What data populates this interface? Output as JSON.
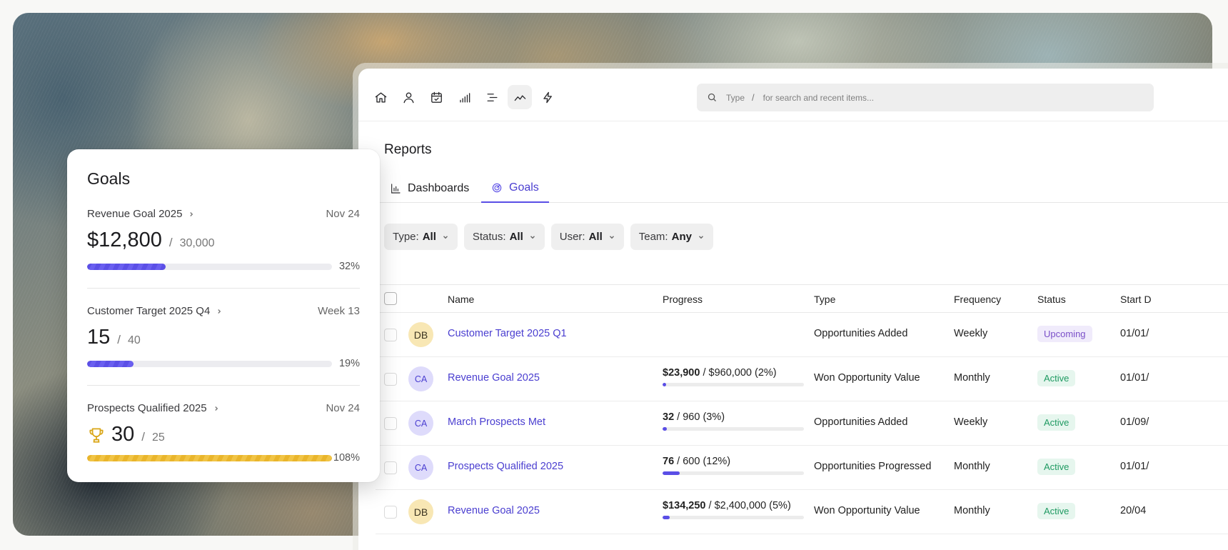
{
  "search": {
    "prefix": "Type",
    "key": "/",
    "suffix": "for search and recent items..."
  },
  "nav": [
    "home-icon",
    "user-icon",
    "calendar-check-icon",
    "signal-bars-icon",
    "list-icon",
    "trend-line-icon",
    "lightning-icon"
  ],
  "page": {
    "title": "Reports"
  },
  "tabs": [
    {
      "label": "Dashboards",
      "icon": "bar-chart-icon"
    },
    {
      "label": "Goals",
      "icon": "target-icon"
    }
  ],
  "filters": [
    {
      "label": "Type:",
      "value": "All"
    },
    {
      "label": "Status:",
      "value": "All"
    },
    {
      "label": "User:",
      "value": "All"
    },
    {
      "label": "Team:",
      "value": "Any"
    }
  ],
  "table": {
    "headers": {
      "name": "Name",
      "progress": "Progress",
      "type": "Type",
      "frequency": "Frequency",
      "status": "Status",
      "start": "Start D"
    },
    "rows": [
      {
        "avatar": "DB",
        "name": "Customer Target 2025 Q1",
        "progress_bold": "",
        "progress_rest": "",
        "progress_fraction": 0,
        "type": "Opportunities Added",
        "frequency": "Weekly",
        "status": "Upcoming",
        "start": "01/01/"
      },
      {
        "avatar": "CA",
        "name": "Revenue Goal 2025",
        "progress_bold": "$23,900",
        "progress_rest": " / $960,000 (2%)",
        "progress_fraction": 0.02,
        "type": "Won Opportunity Value",
        "frequency": "Monthly",
        "status": "Active",
        "start": "01/01/"
      },
      {
        "avatar": "CA",
        "name": "March Prospects Met",
        "progress_bold": "32",
        "progress_rest": " / 960 (3%)",
        "progress_fraction": 0.03,
        "type": "Opportunities Added",
        "frequency": "Weekly",
        "status": "Active",
        "start": "01/09/"
      },
      {
        "avatar": "CA",
        "name": "Prospects Qualified 2025",
        "progress_bold": "76",
        "progress_rest": " / 600 (12%)",
        "progress_fraction": 0.12,
        "type": "Opportunities Progressed",
        "frequency": "Monthly",
        "status": "Active",
        "start": "01/01/"
      },
      {
        "avatar": "DB",
        "name": "Revenue Goal 2025",
        "progress_bold": "$134,250",
        "progress_rest": " / $2,400,000 (5%)",
        "progress_fraction": 0.05,
        "type": "Won Opportunity Value",
        "frequency": "Monthly",
        "status": "Active",
        "start": "20/04"
      }
    ]
  },
  "goals_card": {
    "title": "Goals",
    "items": [
      {
        "name": "Revenue Goal 2025",
        "date": "Nov 24",
        "value": "$12,800",
        "sep": "/",
        "total": "30,000",
        "pct": "32%",
        "fraction": 0.32
      },
      {
        "name": "Customer Target 2025 Q4",
        "date": "Week 13",
        "value": "15",
        "sep": "/",
        "total": "40",
        "pct": "19%",
        "fraction": 0.19
      },
      {
        "name": "Prospects Qualified 2025",
        "date": "Nov 24",
        "value": "30",
        "sep": "/",
        "total": "25",
        "pct": "108%",
        "fraction": 1.0,
        "icon": "trophy-icon"
      }
    ]
  },
  "colors": {
    "accent": "#5a4ee6",
    "active_green": "#1f9a62",
    "upcoming_purple": "#7a4fc8",
    "gold": "#e9b52b"
  }
}
